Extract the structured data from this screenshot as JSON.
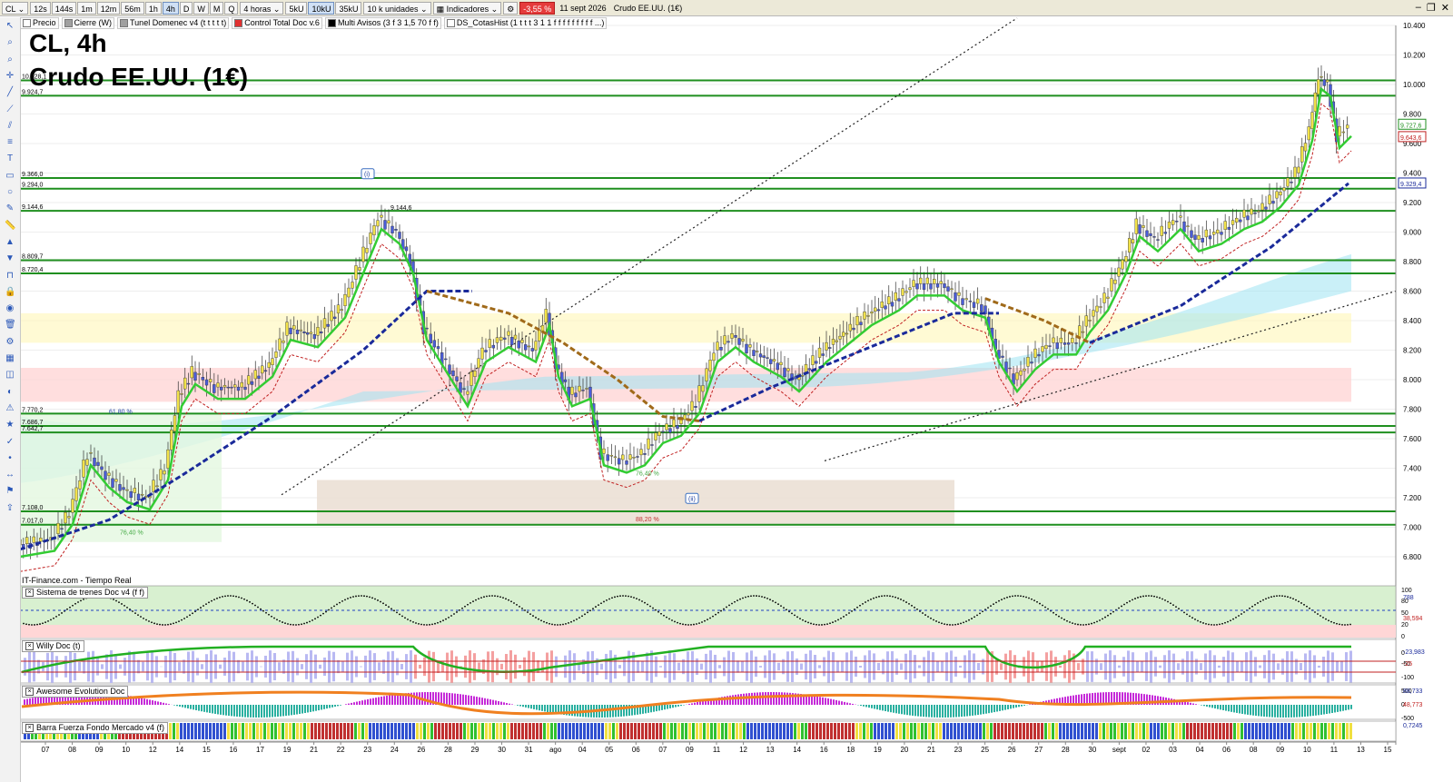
{
  "toolbar": {
    "symbol": "CL",
    "timeframes": [
      "12s",
      "144s",
      "1m",
      "12m",
      "56m",
      "1h",
      "4h",
      "D",
      "W",
      "M",
      "Q"
    ],
    "active_timeframe": "4h",
    "period": "4 horas",
    "unit_buttons": [
      "5kU",
      "10kU",
      "35kU"
    ],
    "active_unit": "10kU",
    "units_select": "10 k unidades",
    "indicators_label": "Indicadores",
    "change_badge": "-3,55 %",
    "date_label": "11 sept 2026",
    "instrument_label": "Crudo EE.UU. (1€)"
  },
  "indicator_bar": [
    {
      "label": "Precio",
      "color": "#ffffff"
    },
    {
      "label": "Cierre (W)",
      "color": "#a0a0a0"
    },
    {
      "label": "Tunel Domenec v4 (t t t t t)",
      "color": "#a0a0a0"
    },
    {
      "label": "Control Total Doc v.6",
      "color": "#e03030"
    },
    {
      "label": "Multi Avisos (3 f 3 1,5 70 f f)",
      "color": "#000000"
    },
    {
      "label": "DS_CotasHist (1 t t t 3 1 1 f f f f f f f f f ...)",
      "color": "#ffffff"
    }
  ],
  "chart_title": "CL, 4h",
  "chart_subtitle": "Crudo EE.UU. (1€)",
  "source": "IT-Finance.com - Tiempo Real",
  "colors": {
    "bull": "#33cc33",
    "bear": "#d02020",
    "support": "#1f8f1f",
    "trend_blue": "#1a2a9a",
    "trend_brown": "#a06a1a"
  },
  "price_axis": {
    "ticks": [
      "10.400",
      "10.200",
      "10.000",
      "9.800",
      "9.600",
      "9.400",
      "9.200",
      "9.000",
      "8.800",
      "8.600",
      "8.400",
      "8.200",
      "8.000",
      "7.800",
      "7.600",
      "7.400",
      "7.200",
      "7.000",
      "6.800"
    ],
    "last_price": "9.727,6",
    "marker_2": "9.643,6",
    "marker_3": "9.329,4"
  },
  "level_labels": [
    "10.028,1",
    "9.924,7",
    "9.366,0",
    "9.294,0",
    "9.144,6",
    "8.809,7",
    "8.720,4",
    "7.770,2",
    "7.686,7",
    "7.642,7",
    "7.108,0",
    "7.017,0"
  ],
  "fib_labels": [
    "61,80 %",
    "76,40 %",
    "88,20 %",
    "76,40 %"
  ],
  "wave_labels": [
    "(i)",
    "(ii)"
  ],
  "time_axis": {
    "labels": [
      "07",
      "08",
      "09",
      "10",
      "12",
      "14",
      "15",
      "16",
      "17",
      "19",
      "21",
      "22",
      "23",
      "24",
      "26",
      "28",
      "29",
      "30",
      "31",
      "ago",
      "04",
      "05",
      "06",
      "07",
      "09",
      "11",
      "12",
      "13",
      "14",
      "16",
      "18",
      "19",
      "20",
      "21",
      "23",
      "25",
      "26",
      "27",
      "28",
      "30",
      "sept",
      "02",
      "03",
      "04",
      "06",
      "08",
      "09",
      "10",
      "11",
      "13",
      "15"
    ]
  },
  "panes": [
    {
      "title": "Sistema de trenes Doc v4 (f f)",
      "scale": [
        "100",
        "80",
        "50",
        "20",
        "0"
      ],
      "values": [
        "788",
        "38,594"
      ]
    },
    {
      "title": "Willy Doc (t)",
      "scale": [
        "0",
        "-50",
        "-100"
      ],
      "values": [
        "-23,983",
        "-25"
      ]
    },
    {
      "title": "Awesome Evolution Doc",
      "scale": [
        "500",
        "0",
        "-500"
      ],
      "values": [
        "88,733",
        "48,773"
      ]
    },
    {
      "title": "Barra Fuerza Fondo Mercado v4 (f)",
      "scale": [],
      "values": [
        "0,7245"
      ]
    }
  ]
}
